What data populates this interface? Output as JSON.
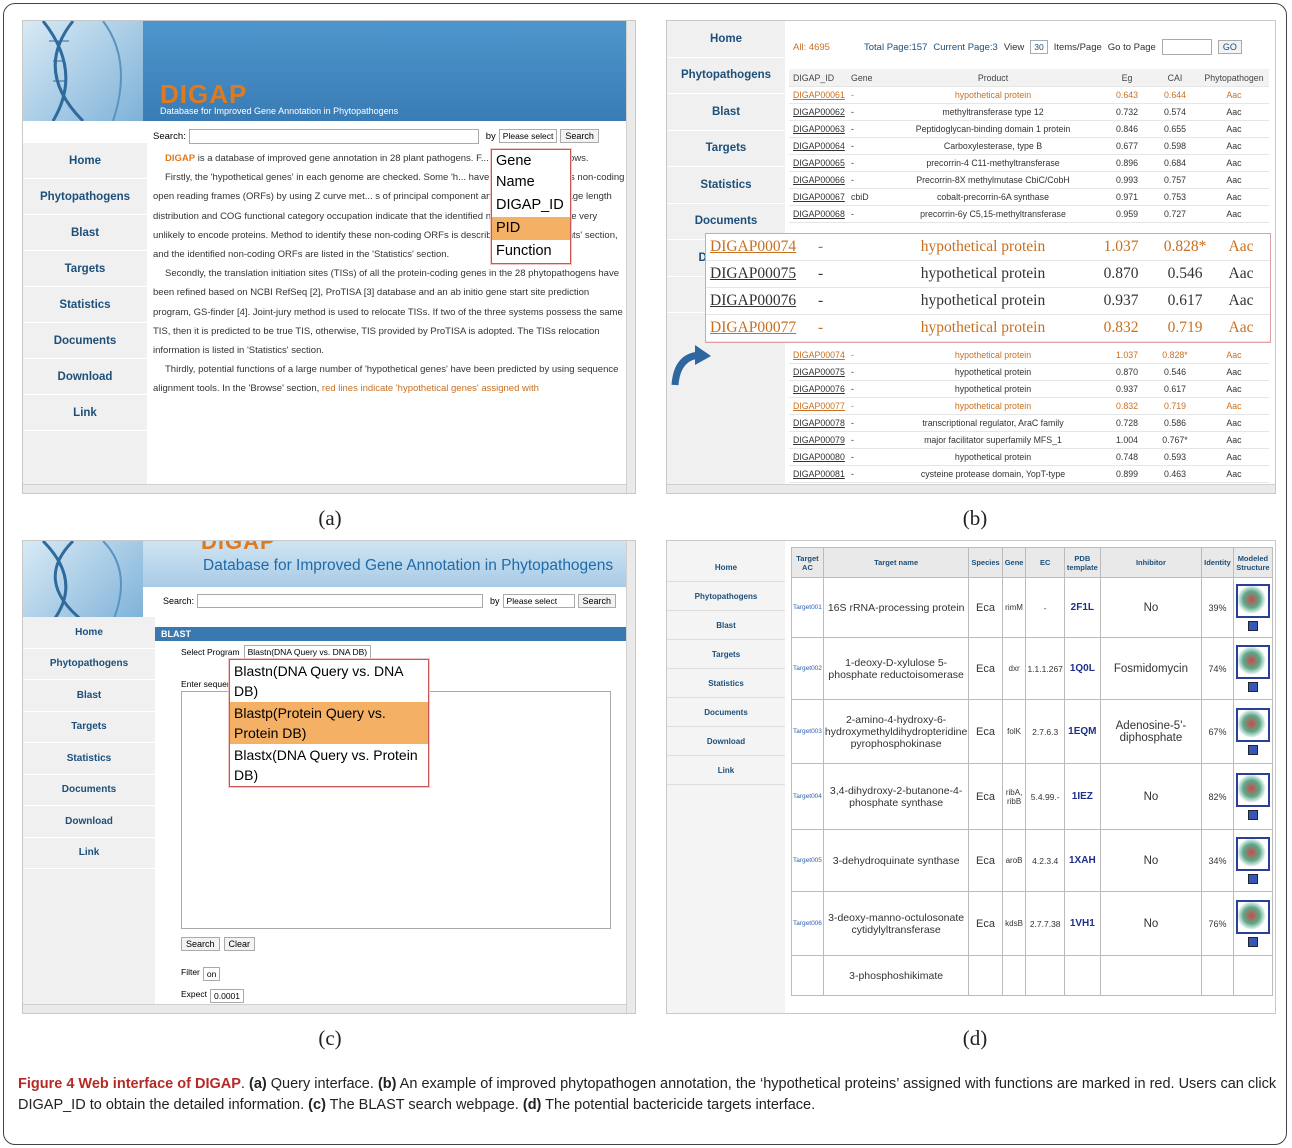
{
  "panels": {
    "a": "(a)",
    "b": "(b)",
    "c": "(c)",
    "d": "(d)"
  },
  "nav_items": [
    "Home",
    "Phytopathogens",
    "Blast",
    "Targets",
    "Statistics",
    "Documents",
    "Download",
    "Link"
  ],
  "panel_a": {
    "brand": "DIGAP",
    "subtitle": "Database for Improved Gene Annotation in Phytopathogens",
    "search_label": "Search:",
    "by_label": "by",
    "select_value": "Please select",
    "search_button": "Search",
    "dropdown": [
      "Gene Name",
      "DIGAP_ID",
      "PID",
      "Function"
    ],
    "dropdown_selected": "PID",
    "paragraphs": [
      {
        "bold": "DIGAP",
        "text": " is a database of improved gene annotation in 28 plant pathogens. F... ...abase are as follows."
      },
      {
        "text": "Firstly, the 'hypothetical genes' in each genome are checked. Some 'h... have been recognized as non-coding open reading frames (ORFs) by using Z curve met... s of principal component analysis (PCA), average length distribution and COG functional category occupation indicate that the identified non-coding ORFs are very unlikely to encode proteins. Method to identify these non-coding ORFs is described in the 'Documents' section, and the identified non-coding ORFs are listed in the 'Statistics' section."
      },
      {
        "text": "Secondly, the translation initiation sites (TISs) of all the protein-coding genes in the 28 phytopathogens have been refined based on NCBI RefSeq [2], ProTISA [3] database and an ab initio gene start site prediction program, GS-finder [4]. Joint-jury method is used to relocate TISs. If two of the three systems possess the same TIS, then it is predicted to be true TIS, otherwise, TIS provided by ProTISA is adopted. The TISs relocation information is listed in 'Statistics' section."
      },
      {
        "text": "Thirdly, potential functions of a large number of 'hypothetical genes' have been predicted by using sequence alignment tools. In the 'Browse' section, ",
        "red": "red lines indicate 'hypothetical genes' assigned with"
      }
    ]
  },
  "panel_b": {
    "all_label": "All: 4695",
    "total_page": "Total Page:157",
    "current_page": "Current Page:3",
    "view_label": "View",
    "view_value": "30",
    "items_label": "Items/Page",
    "goto_label": "Go to Page",
    "go_button": "GO",
    "columns": [
      "DIGAP_ID",
      "Gene",
      "Product",
      "Eg",
      "CAI",
      "Phytopathogen"
    ],
    "rows": [
      [
        "DIGAP00061",
        "-",
        "hypothetical protein",
        "0.643",
        "0.644",
        "Aac",
        true
      ],
      [
        "DIGAP00062",
        "-",
        "methyltransferase type 12",
        "0.732",
        "0.574",
        "Aac",
        false
      ],
      [
        "DIGAP00063",
        "-",
        "Peptidoglycan-binding domain 1 protein",
        "0.846",
        "0.655",
        "Aac",
        false
      ],
      [
        "DIGAP00064",
        "-",
        "Carboxylesterase, type B",
        "0.677",
        "0.598",
        "Aac",
        false
      ],
      [
        "DIGAP00065",
        "-",
        "precorrin-4 C11-methyltransferase",
        "0.896",
        "0.684",
        "Aac",
        false
      ],
      [
        "DIGAP00066",
        "-",
        "Precorrin-8X methylmutase CbiC/CobH",
        "0.993",
        "0.757",
        "Aac",
        false
      ],
      [
        "DIGAP00067",
        "cbiD",
        "cobalt-precorrin-6A synthase",
        "0.971",
        "0.753",
        "Aac",
        false
      ],
      [
        "DIGAP00068",
        "-",
        "precorrin-6y C5,15-methyltransferase",
        "0.959",
        "0.727",
        "Aac",
        false
      ]
    ],
    "zoom_rows": [
      [
        "DIGAP00074",
        "-",
        "hypothetical protein",
        "1.037",
        "0.828*",
        "Aac",
        true
      ],
      [
        "DIGAP00075",
        "-",
        "hypothetical protein",
        "0.870",
        "0.546",
        "Aac",
        false
      ],
      [
        "DIGAP00076",
        "-",
        "hypothetical protein",
        "0.937",
        "0.617",
        "Aac",
        false
      ],
      [
        "DIGAP00077",
        "-",
        "hypothetical protein",
        "0.832",
        "0.719",
        "Aac",
        true
      ]
    ],
    "rows2": [
      [
        "DIGAP00074",
        "-",
        "hypothetical protein",
        "1.037",
        "0.828*",
        "Aac",
        true
      ],
      [
        "DIGAP00075",
        "-",
        "hypothetical protein",
        "0.870",
        "0.546",
        "Aac",
        false
      ],
      [
        "DIGAP00076",
        "-",
        "hypothetical protein",
        "0.937",
        "0.617",
        "Aac",
        false
      ],
      [
        "DIGAP00077",
        "-",
        "hypothetical protein",
        "0.832",
        "0.719",
        "Aac",
        true
      ],
      [
        "DIGAP00078",
        "-",
        "transcriptional regulator, AraC family",
        "0.728",
        "0.586",
        "Aac",
        false
      ],
      [
        "DIGAP00079",
        "-",
        "major facilitator superfamily MFS_1",
        "1.004",
        "0.767*",
        "Aac",
        false
      ],
      [
        "DIGAP00080",
        "-",
        "hypothetical protein",
        "0.748",
        "0.593",
        "Aac",
        false
      ],
      [
        "DIGAP00081",
        "-",
        "cysteine protease domain, YopT-type",
        "0.899",
        "0.463",
        "Aac",
        false
      ]
    ]
  },
  "panel_c": {
    "brand": "DIGAP",
    "subtitle": "Database for Improved Gene Annotation in Phytopathogens",
    "search_label": "Search:",
    "by_label": "by",
    "select_value": "Please select",
    "search_button": "Search",
    "section": "BLAST",
    "program_label": "Select Program",
    "program_value": "Blastn(DNA Query vs. DNA DB)",
    "enter_label": "Enter sequenc",
    "dropdown": [
      "Blastn(DNA Query vs. DNA DB)",
      "Blastp(Protein Query vs. Protein DB)",
      "Blastx(DNA Query vs. Protein DB)"
    ],
    "dropdown_selected": "Blastp(Protein Query vs. Protein DB)",
    "search_btn": "Search",
    "clear_btn": "Clear",
    "filter_label": "Filter",
    "filter_value": "on",
    "expect_label": "Expect",
    "expect_value": "0.0001"
  },
  "panel_d": {
    "columns": [
      "Target AC",
      "Target name",
      "Species",
      "Gene",
      "EC",
      "PDB template",
      "Inhibitor",
      "Identity",
      "Modeled Structure"
    ],
    "rows": [
      [
        "Target001",
        "16S rRNA-processing protein",
        "Eca",
        "rimM",
        "-",
        "2F1L",
        "No",
        "39%"
      ],
      [
        "Target002",
        "1-deoxy-D-xylulose 5-phosphate reductoisomerase",
        "Eca",
        "dxr",
        "1.1.1.267",
        "1Q0L",
        "Fosmidomycin",
        "74%"
      ],
      [
        "Target003",
        "2-amino-4-hydroxy-6-hydroxymethyldihydropteridine pyrophosphokinase",
        "Eca",
        "folK",
        "2.7.6.3",
        "1EQM",
        "Adenosine-5'-diphosphate",
        "67%"
      ],
      [
        "Target004",
        "3,4-dihydroxy-2-butanone-4-phosphate synthase",
        "Eca",
        "ribA, ribB",
        "5.4.99.-",
        "1IEZ",
        "No",
        "82%"
      ],
      [
        "Target005",
        "3-dehydroquinate synthase",
        "Eca",
        "aroB",
        "4.2.3.4",
        "1XAH",
        "No",
        "34%"
      ],
      [
        "Target006",
        "3-deoxy-manno-octulosonate cytidylyltransferase",
        "Eca",
        "kdsB",
        "2.7.7.38",
        "1VH1",
        "No",
        "76%"
      ],
      [
        "",
        "3-phosphoshikimate",
        "",
        "",
        "",
        "",
        "",
        ""
      ]
    ]
  },
  "caption": {
    "label": "Figure 4 Web interface of DIGAP",
    "text1": ". ",
    "a": "(a)",
    "ta": " Query interface. ",
    "b": "(b)",
    "tb": " An example of improved phytopathogen annotation, the ‘hypothetical proteins’ assigned with functions are marked in red. Users can click DIGAP_ID to obtain the detailed information. ",
    "c": "(c)",
    "tc": " The BLAST search webpage. ",
    "d": "(d)",
    "td": " The potential bactericide targets interface."
  },
  "colors": {
    "header_blue": "#3f86bf",
    "nav_text": "#1c4f7a",
    "red_text": "#c87020",
    "brand_orange": "#e07a1e"
  }
}
